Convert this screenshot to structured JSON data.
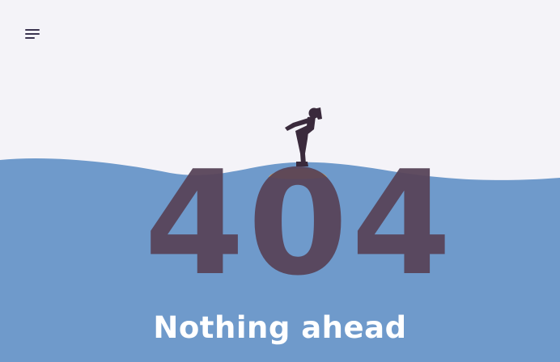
{
  "header": {
    "menu_icon": "hamburger-menu-icon"
  },
  "hero": {
    "code": "404",
    "headline": "Nothing ahead",
    "figure_icon": "person-looking-ahead-icon"
  },
  "colors": {
    "background": "#f4f3f8",
    "water": "#6f9acb",
    "digits": "#574358",
    "sun": "#f4a83c",
    "figure": "#3a2a3c",
    "headline": "#ffffff"
  }
}
